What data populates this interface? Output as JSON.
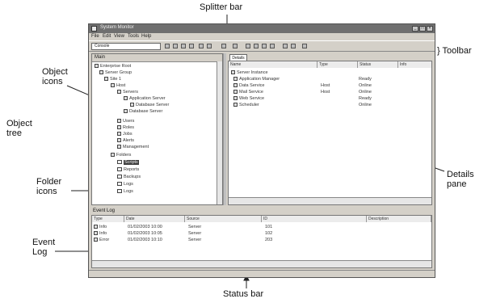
{
  "callouts": {
    "splitter_bar": "Splitter bar",
    "toolbar": "} Toolbar",
    "object_icons": "Object icons",
    "object_tree": "Object tree",
    "details_pane": "Details pane",
    "folder_icons": "Folder icons",
    "event_log": "Event Log",
    "status_bar": "Status bar"
  },
  "window": {
    "title": "System Monitor",
    "menu": [
      "File",
      "Edit",
      "View",
      "Tools",
      "Help"
    ],
    "combo_value": "Console",
    "tree_header": "Main",
    "tab_label": "Details",
    "event_header": "Event Log"
  },
  "tree": {
    "rows": [
      "Enterprise Root",
      "Server Group",
      "Site 1",
      "Host",
      "Servers",
      "Application Server",
      "Database Server",
      "Users",
      "Roles",
      "Jobs",
      "Alerts",
      "Management",
      "Folders",
      "Scripts",
      "Reports",
      "Backups",
      "Logs"
    ]
  },
  "details": {
    "columns": [
      "Name",
      "Type",
      "Status",
      "Info"
    ],
    "rows": [
      {
        "name": "Server Instance",
        "type": "",
        "status": ""
      },
      {
        "name": "Application Manager",
        "type": "",
        "status": "Ready"
      },
      {
        "name": "Data Service",
        "type": "Host",
        "status": "Online"
      },
      {
        "name": "Mail Service",
        "type": "Host",
        "status": "Online"
      },
      {
        "name": "Web Service",
        "type": "",
        "status": "Ready"
      },
      {
        "name": "Scheduler",
        "type": "",
        "status": "Online"
      }
    ]
  },
  "event_log": {
    "columns": [
      "Type",
      "Date",
      "Source",
      "ID",
      "Description"
    ],
    "rows": [
      {
        "type": "Info",
        "date": "01/02/2003 10:00",
        "source": "Server",
        "id": "101"
      },
      {
        "type": "Info",
        "date": "01/02/2003 10:05",
        "source": "Server",
        "id": "102"
      },
      {
        "type": "Error",
        "date": "01/02/2003 10:10",
        "source": "Server",
        "id": "203"
      }
    ]
  }
}
